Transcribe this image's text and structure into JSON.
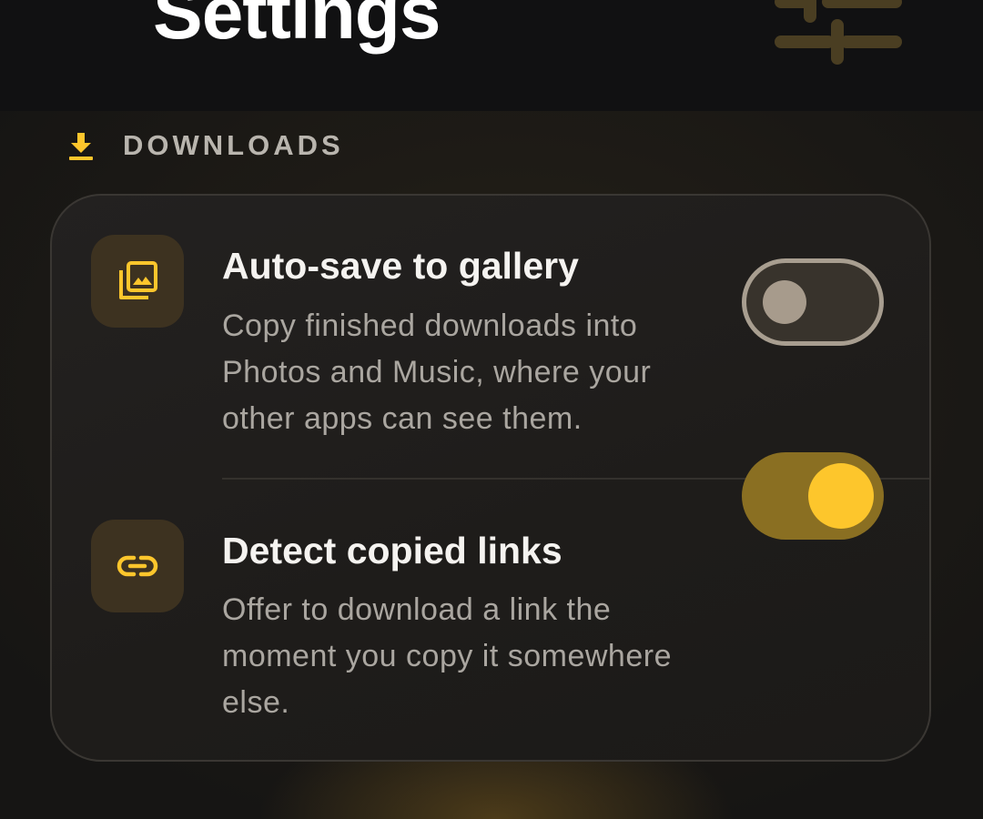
{
  "header": {
    "title": "Settings",
    "icon": "sliders-icon"
  },
  "section": {
    "label": "DOWNLOADS",
    "icon": "download-icon"
  },
  "settings": [
    {
      "icon": "gallery-icon",
      "title": "Auto-save to gallery",
      "description": "Copy finished downloads into Photos and Music, where your other apps can see them.",
      "enabled": false
    },
    {
      "icon": "link-icon",
      "title": "Detect copied links",
      "description": "Offer to download a link the moment you copy it somewhere else.",
      "enabled": true
    }
  ],
  "colors": {
    "accent": "#fdc62c",
    "accent_dim": "#8a6f22",
    "background": "#161514",
    "card": "#211f1d",
    "text_primary": "#f5f3f0",
    "text_secondary": "#aaa6a0"
  }
}
